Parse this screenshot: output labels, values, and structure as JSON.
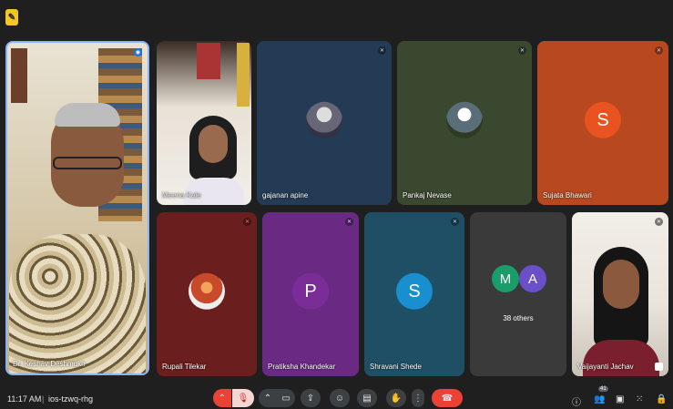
{
  "meeting": {
    "time": "11:17 AM",
    "separator": "|",
    "code": "ios-tzwq-rhg",
    "participant_count": "41"
  },
  "colors": {
    "background": "#1f1f1f",
    "tile_blue": "#243b55",
    "tile_olive": "#3b4830",
    "tile_rust": "#b7481f",
    "tile_maroon": "#6b1e1e",
    "tile_purple": "#6a2a84",
    "tile_teal": "#1f4f64",
    "tile_gray": "#3a3a3a",
    "end_call": "#ea4335"
  },
  "participants": {
    "main_speaker": {
      "name": "Dr. Keshav Deshmukh",
      "mic": "speaking"
    },
    "p1": {
      "name": "Meena Kale"
    },
    "p2": {
      "name": "gajanan apine"
    },
    "p3": {
      "name": "Pankaj Nevase"
    },
    "p4": {
      "name": "Sujata Bhawari",
      "initial": "S"
    },
    "p5": {
      "name": "Rupali Tilekar"
    },
    "p6": {
      "name": "Pratiksha Khandekar",
      "initial": "P"
    },
    "p7": {
      "name": "Shravani Shede",
      "initial": "S"
    },
    "others": {
      "initial_1": "M",
      "initial_2": "A",
      "label": "38 others"
    },
    "p8": {
      "name": "Vaijayanti Jachav"
    }
  },
  "icons": {
    "top_badge": "notes-icon",
    "mic_off": "mic-off-icon",
    "camera": "camera-icon",
    "present": "present-icon",
    "emoji": "emoji-icon",
    "captions": "captions-icon",
    "raise_hand": "hand-icon",
    "more": "more-vert-icon",
    "end_call": "end-call-icon",
    "info": "info-icon",
    "people": "people-icon",
    "chat": "chat-icon",
    "activities": "grid-icon",
    "host": "lock-icon"
  }
}
